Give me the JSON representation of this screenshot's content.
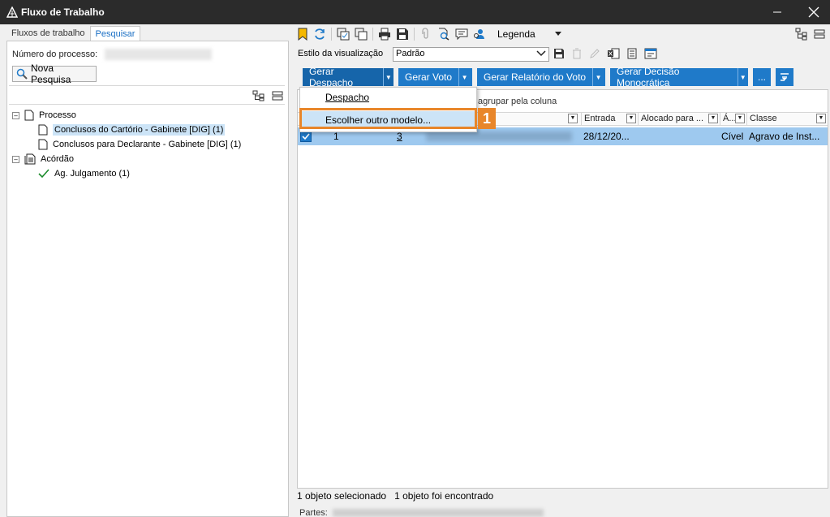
{
  "window": {
    "title": "Fluxo de Trabalho"
  },
  "left": {
    "tabs": [
      "Fluxos de trabalho",
      "Pesquisar"
    ],
    "search_label": "Número do processo:",
    "new_search_label": "Nova Pesquisa",
    "tree": {
      "processo": "Processo",
      "processo_children": [
        "Conclusos do Cartório - Gabinete [DIG] (1)",
        "Conclusos para Declarante - Gabinete [DIG] (1)"
      ],
      "acordao": "Acórdão",
      "acordao_children": [
        "Ag. Julgamento (1)"
      ]
    }
  },
  "toolbar": {
    "legend_label": "Legenda"
  },
  "view_style": {
    "label": "Estilo da visualização",
    "value": "Padrão"
  },
  "action_buttons": [
    "Gerar Despacho",
    "Gerar Voto",
    "Gerar Relatório do Voto",
    "Gerar Decisão Monocrática",
    "..."
  ],
  "menu": {
    "items": [
      "Despacho",
      "Escolher outro modelo..."
    ]
  },
  "callout": {
    "number": "1"
  },
  "grid": {
    "group_hint": "agrupar pela coluna",
    "columns": [
      "Entrada",
      "Alocado para ...",
      "Á...",
      "Classe"
    ],
    "row": {
      "col1": "1",
      "col2": "3",
      "entrada": "28/12/20...",
      "area": "Cível",
      "classe": "Agravo de Inst..."
    }
  },
  "status": {
    "selected": "1 objeto selecionado",
    "found": "1 objeto foi encontrado",
    "partes_label": "Partes:"
  },
  "colors": {
    "accent": "#1f7ac9",
    "callout": "#e8862a",
    "titlebar": "#2b2b2b",
    "selection": "#9ec9ef"
  }
}
